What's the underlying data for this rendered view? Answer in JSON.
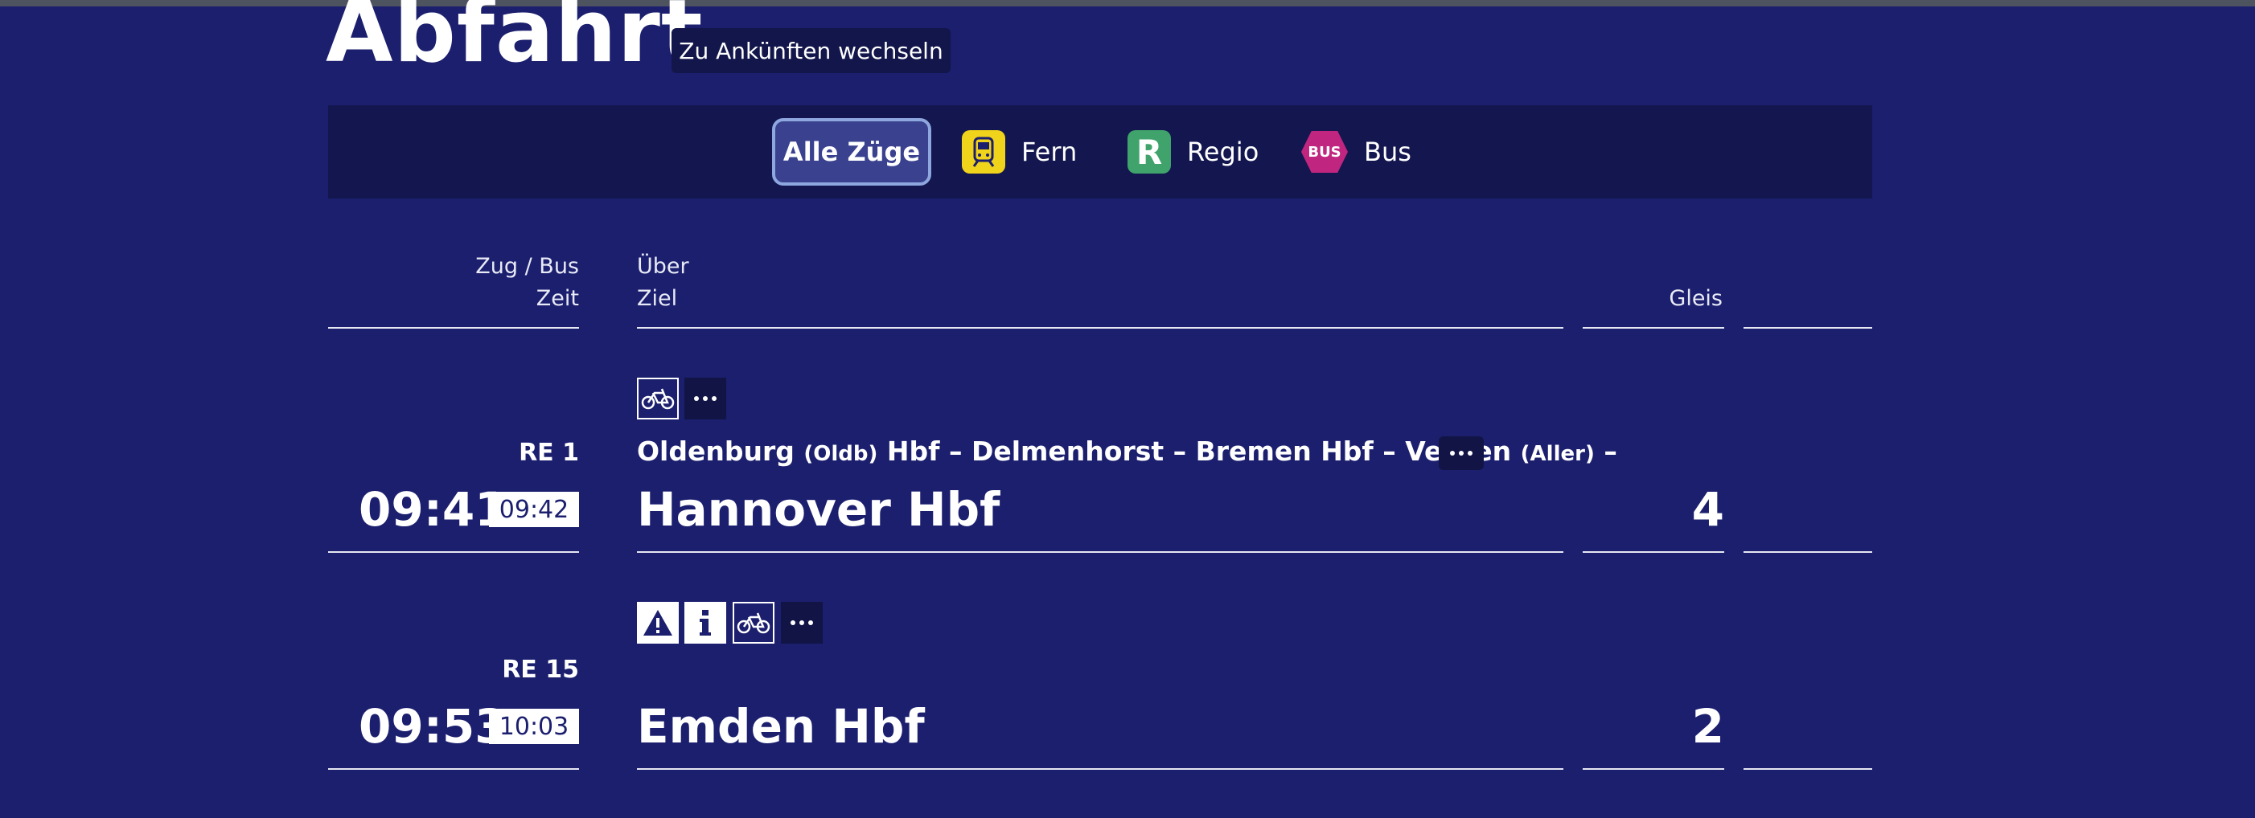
{
  "header": {
    "title": "Abfahrt",
    "switch_label": "Zu Ankünften wechseln"
  },
  "filters": {
    "all_label": "Alle Züge",
    "fern_label": "Fern",
    "regio_label": "Regio",
    "regio_icon_text": "R",
    "bus_label": "Bus",
    "bus_icon_text": "BUS"
  },
  "columns": {
    "train": "Zug / Bus",
    "time": "Zeit",
    "via": "Über",
    "destination": "Ziel",
    "platform": "Gleis"
  },
  "departures": [
    {
      "train": "RE 1",
      "time": "09:41",
      "actual": "09:42",
      "via_parts": [
        "Oldenburg ",
        "(Oldb)",
        " Hbf – Delmenhorst – Bremen Hbf – Verden ",
        "(Aller)",
        " –"
      ],
      "destination": "Hannover Hbf",
      "platform": "4",
      "icons": [
        "bicycle-icon",
        "more-icon"
      ]
    },
    {
      "train": "RE 15",
      "time": "09:53",
      "actual": "10:03",
      "destination": "Emden Hbf",
      "platform": "2",
      "icons": [
        "warning-icon",
        "info-icon",
        "bicycle-icon",
        "more-icon"
      ]
    }
  ],
  "colors": {
    "background": "#1b1f6e",
    "filterbar": "#13164f",
    "fern": "#f0d31b",
    "regio": "#3fa36b",
    "bus": "#c0267f"
  }
}
